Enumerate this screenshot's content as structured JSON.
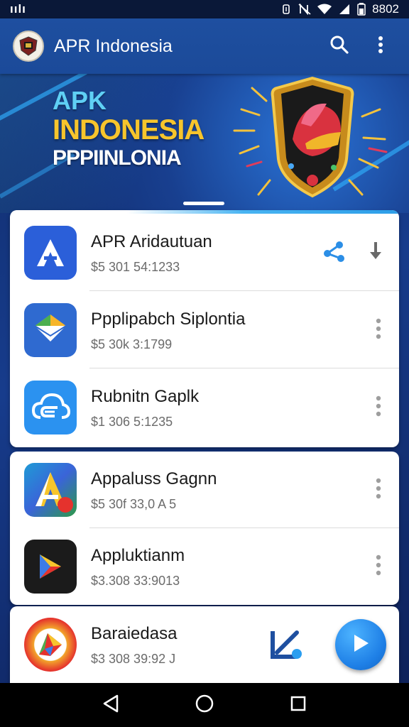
{
  "status_bar": {
    "left_label": "ıılı",
    "time": "8802",
    "icons": [
      "vibrate-icon",
      "no-nfc-icon",
      "wifi-icon",
      "signal-icon",
      "battery-icon"
    ]
  },
  "app_bar": {
    "title": "APR Indonesia",
    "logo_icon": "emblem-logo",
    "actions": [
      "search-icon",
      "more-vert-icon"
    ]
  },
  "banner": {
    "line1": "APK",
    "line2": "INDONESIA",
    "line3": "PPPIINLONIA",
    "image_icon": "shield-emblem",
    "page_indicator": "active"
  },
  "apps": [
    {
      "title": "APR Aridautuan",
      "subtitle": "$5 301 54:1233",
      "icon": "letter-a-icon",
      "icon_bg": "#2b5fd9",
      "actions": [
        "share-icon",
        "download-icon"
      ]
    },
    {
      "title": "Ppplipabch Siplontia",
      "subtitle": "$5 30k 3:1799",
      "icon": "envelope-icon",
      "icon_bg": "#2f6ad0",
      "actions": [
        "more-vert-icon"
      ]
    },
    {
      "title": "Rubnitn Gaplk",
      "subtitle": "$1 306 5:1235",
      "icon": "cloud-icon",
      "icon_bg": "#2b92f0",
      "actions": [
        "more-vert-icon"
      ]
    },
    {
      "title": "Appaluss Gagnn",
      "subtitle": "$5 30f 33,0 A 5",
      "icon": "colored-a-icon",
      "icon_bg": "#3a64d8",
      "actions": [
        "more-vert-icon"
      ]
    },
    {
      "title": "Appluktianm",
      "subtitle": "$3.308 33:9013",
      "icon": "play-p-icon",
      "icon_bg": "#1b1b1b",
      "actions": [
        "more-vert-icon"
      ]
    },
    {
      "title": "Baraiedasa",
      "subtitle": "$3 308 39:92 J",
      "icon": "colorful-play-icon",
      "icon_bg": "#f2a52b",
      "actions": [
        "edit-tool-icon",
        "play-icon"
      ]
    }
  ],
  "colors": {
    "app_bar": "#1b4a99",
    "background": "#173c8c",
    "accent": "#2b9ef0",
    "more_icon": "#9e9e9e",
    "fab": "#1e7fe6"
  },
  "nav_bar": {
    "buttons": [
      "back-icon",
      "home-icon",
      "recents-icon"
    ]
  }
}
